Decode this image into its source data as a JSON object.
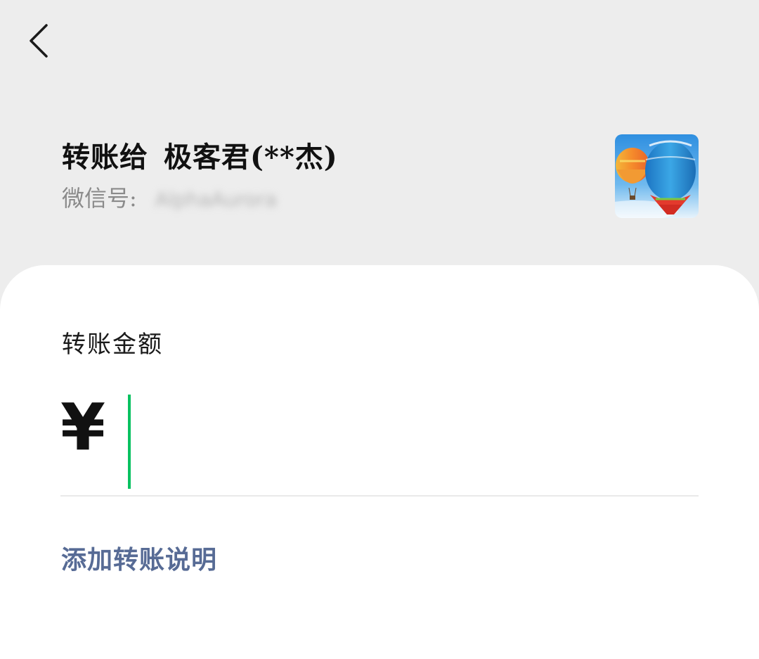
{
  "header": {
    "back_icon": "chevron-left-icon"
  },
  "recipient": {
    "transfer_to_label": "转账给",
    "name": "极客君(**杰)",
    "wechat_id_label": "微信号:",
    "wechat_id_value": "AlphaAurora",
    "avatar_icon": "hot-air-balloon-avatar"
  },
  "amount": {
    "label": "转账金额",
    "currency_symbol": "¥",
    "value": ""
  },
  "note": {
    "add_label": "添加转账说明"
  },
  "colors": {
    "page_background": "#ededed",
    "card_background": "#ffffff",
    "caret": "#07c160",
    "link": "#576b95"
  }
}
